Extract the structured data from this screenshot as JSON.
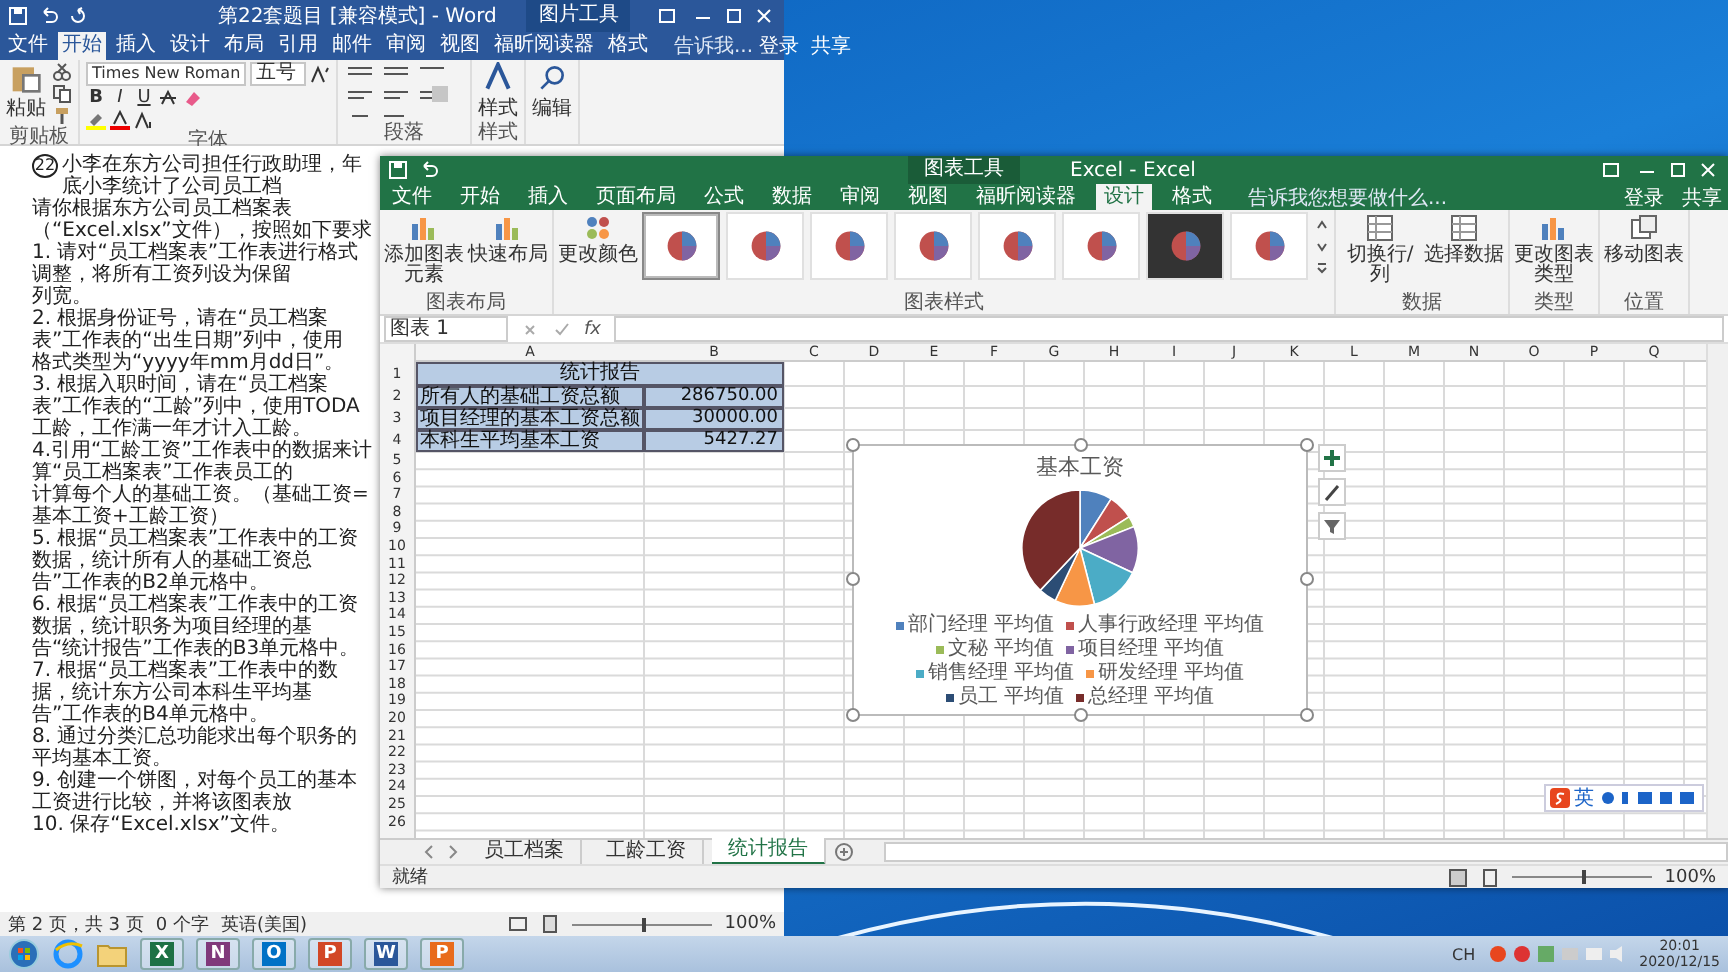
{
  "word": {
    "title": "第22套题目 [兼容模式] - Word",
    "context_tab": "图片工具",
    "tabs": [
      {
        "label": "文件",
        "selected": false
      },
      {
        "label": "开始",
        "selected": true
      },
      {
        "label": "插入",
        "selected": false
      },
      {
        "label": "设计",
        "selected": false
      },
      {
        "label": "布局",
        "selected": false
      },
      {
        "label": "引用",
        "selected": false
      },
      {
        "label": "邮件",
        "selected": false
      },
      {
        "label": "审阅",
        "selected": false
      },
      {
        "label": "视图",
        "selected": false
      },
      {
        "label": "福昕阅读器",
        "selected": false
      },
      {
        "label": "格式",
        "selected": false
      }
    ],
    "search": "告诉我...",
    "login": "登录",
    "share": "共享",
    "ribbon": {
      "paste": "粘贴",
      "font_name": "Times New Roman",
      "font_size": "五号",
      "format_buttons": [
        "B",
        "I",
        "U"
      ],
      "styles": "样式",
      "editing": "编辑",
      "groups": [
        "剪贴板",
        "字体",
        "段落",
        "样式"
      ]
    },
    "document": {
      "number": "22",
      "paragraphs": [
        "小李在东方公司担任行政助理，年底小李统计了公司员工档",
        "请你根据东方公司员工档案表（“Excel.xlsx”文件），按照如下要求",
        "1. 请对“员工档案表”工作表进行格式调整，将所有工资列设为保留",
        "列宽。",
        "2. 根据身份证号，请在“员工档案表”工作表的“出生日期”列中，使用",
        "格式类型为“yyyy年mm月dd日”。",
        "3. 根据入职时间，请在“员工档案表”工作表的“工龄”列中，使用TODA",
        "工龄，工作满一年才计入工龄。",
        "4.引用“工龄工资”工作表中的数据来计算“员工档案表”工作表员工的",
        "计算每个人的基础工资。（基础工资=基本工资+工龄工资）",
        "5. 根据“员工档案表”工作表中的工资数据，统计所有人的基础工资总",
        "告”工作表的B2单元格中。",
        "6. 根据“员工档案表”工作表中的工资数据，统计职务为项目经理的基",
        "告“统计报告”工作表的B3单元格中。",
        "7. 根据“员工档案表”工作表中的数据，统计东方公司本科生平均基",
        "告”工作表的B4单元格中。",
        "8. 通过分类汇总功能求出每个职务的平均基本工资。",
        "9. 创建一个饼图，对每个员工的基本工资进行比较，并将该图表放",
        "10. 保存“Excel.xlsx”文件。"
      ]
    },
    "status": {
      "page": "第 2 页，共 3 页",
      "words": "0 个字",
      "language": "英语(美国)",
      "zoom": "100%",
      "level": 0.5
    }
  },
  "excel": {
    "title": "Excel - Excel",
    "context_tab": "图表工具",
    "tabs": [
      {
        "label": "文件",
        "selected": false
      },
      {
        "label": "开始",
        "selected": false
      },
      {
        "label": "插入",
        "selected": false
      },
      {
        "label": "页面布局",
        "selected": false
      },
      {
        "label": "公式",
        "selected": false
      },
      {
        "label": "数据",
        "selected": false
      },
      {
        "label": "审阅",
        "selected": false
      },
      {
        "label": "视图",
        "selected": false
      },
      {
        "label": "福昕阅读器",
        "selected": false
      },
      {
        "label": "设计",
        "selected": true
      },
      {
        "label": "格式",
        "selected": false
      }
    ],
    "search": "告诉我您想要做什么...",
    "login": "登录",
    "share": "共享",
    "ribbon": {
      "layout_buttons": [
        "添加图表元素",
        "快速布局"
      ],
      "change_colors": "更改颜色",
      "chart_styles": [
        {
          "kind": "light",
          "selected": true
        },
        {
          "kind": "light",
          "selected": false
        },
        {
          "kind": "light",
          "selected": false
        },
        {
          "kind": "light",
          "selected": false
        },
        {
          "kind": "light",
          "selected": false
        },
        {
          "kind": "light",
          "selected": false
        },
        {
          "kind": "dark",
          "selected": false
        },
        {
          "kind": "light",
          "selected": false
        }
      ],
      "data_buttons": [
        "切换行/列",
        "选择数据"
      ],
      "type_button": "更改图表类型",
      "location_button": "移动图表",
      "groups": [
        "图表布局",
        "图表样式",
        "数据",
        "类型",
        "位置"
      ]
    },
    "name_box": "图表 1",
    "function_label": "fx",
    "sheet": {
      "columns": [
        "A",
        "B",
        "C",
        "D",
        "E",
        "F",
        "G",
        "H",
        "I",
        "J",
        "K",
        "L",
        "M",
        "N",
        "O",
        "P",
        "Q"
      ],
      "row_numbers": [
        "1",
        "2",
        "3",
        "4",
        "5",
        "6",
        "7",
        "8",
        "9",
        "10",
        "11",
        "12",
        "13",
        "14",
        "15",
        "16",
        "17",
        "18",
        "19",
        "20",
        "21",
        "22",
        "23",
        "24",
        "25",
        "26"
      ],
      "title": "统计报告",
      "rows": [
        {
          "label": "所有人的基础工资总额",
          "value": "286750.00"
        },
        {
          "label": "项目经理的基本工资总额",
          "value": "30000.00"
        },
        {
          "label": "本科生平均基本工资",
          "value": "5427.27"
        }
      ]
    },
    "chart": {
      "title": "基本工资",
      "selected": true,
      "legend": [
        {
          "label": "部门经理 平均值",
          "color": "#4f81bd"
        },
        {
          "label": "人事行政经理 平均值",
          "color": "#c0504d"
        },
        {
          "label": "文秘 平均值",
          "color": "#9bbb59"
        },
        {
          "label": "项目经理 平均值",
          "color": "#8064a2"
        },
        {
          "label": "销售经理 平均值",
          "color": "#4bacc6"
        },
        {
          "label": "研发经理 平均值",
          "color": "#f79646"
        },
        {
          "label": "员工 平均值",
          "color": "#2c4d75"
        },
        {
          "label": "总经理 平均值",
          "color": "#772c2a"
        }
      ]
    },
    "sheet_tabs": [
      {
        "label": "员工档案",
        "selected": false
      },
      {
        "label": "工龄工资",
        "selected": false
      },
      {
        "label": "统计报告",
        "selected": true
      }
    ],
    "status": {
      "text": "就绪",
      "zoom": "100%",
      "level": 0.5
    }
  },
  "ime": {
    "mode": "英"
  },
  "taskbar": {
    "apps": [
      {
        "kind": "ie"
      },
      {
        "kind": "folder"
      },
      {
        "kind": "letter",
        "letter": "X",
        "color": "#1e7145"
      },
      {
        "kind": "letter",
        "letter": "N",
        "color": "#80397b"
      },
      {
        "kind": "letter",
        "letter": "O",
        "color": "#0072c6"
      },
      {
        "kind": "letter",
        "letter": "P",
        "color": "#d24726"
      },
      {
        "kind": "letter",
        "letter": "W",
        "color": "#2b579a"
      },
      {
        "kind": "letter",
        "letter": "P",
        "color": "#e86b1c"
      }
    ],
    "language": "CH",
    "time": "20:01",
    "date": "2020/12/15"
  }
}
